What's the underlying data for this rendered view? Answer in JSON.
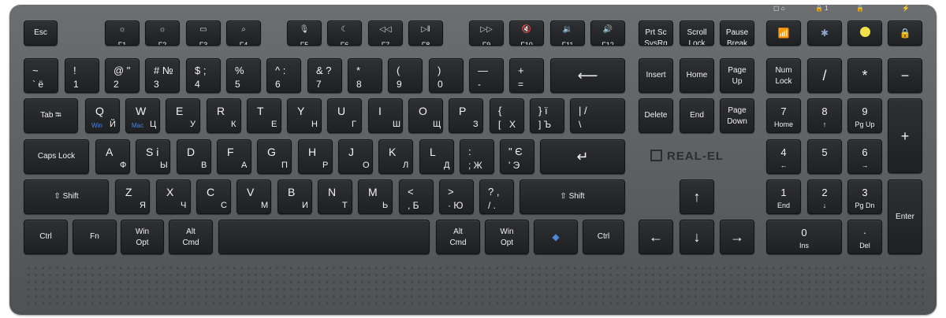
{
  "brand": "REAL-EL",
  "led_labels": [
    "▢ ⌂",
    "🔒 1",
    "🔒",
    "⚡"
  ],
  "rows": [
    [
      {
        "name": "esc",
        "a": "Esc"
      },
      {
        "name": "f1",
        "icon": "☼",
        "fn": "F1"
      },
      {
        "name": "f2",
        "icon": "☼",
        "fn": "F2"
      },
      {
        "name": "f3",
        "icon": "▭",
        "fn": "F3"
      },
      {
        "name": "f4",
        "icon": "⌕",
        "fn": "F4"
      },
      {
        "name": "f5",
        "icon": "🎙",
        "fn": "F5"
      },
      {
        "name": "f6",
        "icon": "☾",
        "fn": "F6"
      },
      {
        "name": "f7",
        "icon": "◁◁",
        "fn": "F7"
      },
      {
        "name": "f8",
        "icon": "▷‖",
        "fn": "F8"
      },
      {
        "name": "f9",
        "icon": "▷▷",
        "fn": "F9"
      },
      {
        "name": "f10",
        "icon": "🔇",
        "fn": "F10"
      },
      {
        "name": "f11",
        "icon": "🔉",
        "fn": "F11"
      },
      {
        "name": "f12",
        "icon": "🔊",
        "fn": "F12"
      },
      {
        "name": "prtsc",
        "a": "Prt Sc",
        "b": "SysRq"
      },
      {
        "name": "scroll-lock",
        "a": "Scroll",
        "b": "Lock"
      },
      {
        "name": "pause",
        "a": "Pause",
        "b": "Break"
      },
      {
        "name": "wifi",
        "icon": "📶"
      },
      {
        "name": "bluetooth",
        "icon": "✱"
      },
      {
        "name": "emoji",
        "smile": true
      },
      {
        "name": "lock",
        "icon": "🔒"
      }
    ],
    [
      {
        "name": "tilde",
        "tl": "~",
        "bl": "` ё",
        "tr": "",
        "br": ""
      },
      {
        "name": "1",
        "tl": "!",
        "bl": "1"
      },
      {
        "name": "2",
        "tl": "@ \"",
        "bl": "2"
      },
      {
        "name": "3",
        "tl": "# №",
        "bl": "3"
      },
      {
        "name": "4",
        "tl": "$ ;",
        "bl": "4"
      },
      {
        "name": "5",
        "tl": "%",
        "bl": "5"
      },
      {
        "name": "6",
        "tl": "^ :",
        "bl": "6"
      },
      {
        "name": "7",
        "tl": "& ?",
        "bl": "7"
      },
      {
        "name": "8",
        "tl": "*",
        "bl": "8"
      },
      {
        "name": "9",
        "tl": "(",
        "bl": "9"
      },
      {
        "name": "0",
        "tl": ")",
        "bl": "0"
      },
      {
        "name": "minus",
        "tl": "—",
        "bl": "-"
      },
      {
        "name": "equals",
        "tl": "+",
        "bl": "="
      },
      {
        "name": "backspace",
        "big": "⟵"
      },
      {
        "name": "insert",
        "a": "Insert"
      },
      {
        "name": "home",
        "a": "Home"
      },
      {
        "name": "page-up",
        "a": "Page",
        "b": "Up"
      },
      {
        "name": "num-lock",
        "a": "Num",
        "b": "Lock"
      },
      {
        "name": "np-slash",
        "big": "/"
      },
      {
        "name": "np-star",
        "big": "*"
      },
      {
        "name": "np-minus",
        "big": "−"
      }
    ],
    [
      {
        "name": "tab",
        "a": "Tab ⭾"
      },
      {
        "name": "q",
        "l": "Q",
        "r": "Й",
        "w": "Win"
      },
      {
        "name": "w",
        "l": "W",
        "r": "Ц",
        "w": "Mac"
      },
      {
        "name": "e",
        "l": "E",
        "r": "У"
      },
      {
        "name": "r",
        "l": "R",
        "r": "К"
      },
      {
        "name": "t",
        "l": "T",
        "r": "Е"
      },
      {
        "name": "y",
        "l": "Y",
        "r": "Н"
      },
      {
        "name": "u",
        "l": "U",
        "r": "Г"
      },
      {
        "name": "i",
        "l": "I",
        "r": "Ш"
      },
      {
        "name": "o",
        "l": "O",
        "r": "Щ"
      },
      {
        "name": "p",
        "l": "P",
        "r": "З"
      },
      {
        "name": "lbracket",
        "tl": "{",
        "bl": "[",
        "tr": "",
        "br": "Х"
      },
      {
        "name": "rbracket",
        "tl": "} ї",
        "bl": "] Ъ"
      },
      {
        "name": "backslash",
        "tl": "|  /",
        "bl": "\\"
      },
      {
        "name": "delete",
        "a": "Delete"
      },
      {
        "name": "end",
        "a": "End"
      },
      {
        "name": "page-down",
        "a": "Page",
        "b": "Down"
      },
      {
        "name": "np-7",
        "t": "7",
        "b": "Home"
      },
      {
        "name": "np-8",
        "t": "8",
        "b": "↑"
      },
      {
        "name": "np-9",
        "t": "9",
        "b": "Pg Up"
      },
      {
        "name": "np-plus",
        "big": "+"
      }
    ],
    [
      {
        "name": "caps-lock",
        "a": "Caps Lock"
      },
      {
        "name": "a",
        "l": "A",
        "r": "Ф"
      },
      {
        "name": "s",
        "l": "S і",
        "r": "Ы"
      },
      {
        "name": "d",
        "l": "D",
        "r": "В"
      },
      {
        "name": "f",
        "l": "F",
        "r": "А"
      },
      {
        "name": "g",
        "l": "G",
        "r": "П"
      },
      {
        "name": "h",
        "l": "H",
        "r": "Р"
      },
      {
        "name": "j",
        "l": "J",
        "r": "О"
      },
      {
        "name": "k",
        "l": "K",
        "r": "Л"
      },
      {
        "name": "l",
        "l": "L",
        "r": "Д"
      },
      {
        "name": "semicolon",
        "tl": ":",
        "bl": ";  Ж"
      },
      {
        "name": "quote",
        "tl": "\" Є",
        "bl": "'  Э"
      },
      {
        "name": "enter",
        "big": "↵"
      },
      {
        "name": "np-4",
        "t": "4",
        "b": "←"
      },
      {
        "name": "np-5",
        "t": "5",
        "b": ""
      },
      {
        "name": "np-6",
        "t": "6",
        "b": "→"
      }
    ],
    [
      {
        "name": "left-shift",
        "a": "⇧ Shift"
      },
      {
        "name": "z",
        "l": "Z",
        "r": "Я"
      },
      {
        "name": "x",
        "l": "X",
        "r": "Ч"
      },
      {
        "name": "c",
        "l": "C",
        "r": "С"
      },
      {
        "name": "v",
        "l": "V",
        "r": "М"
      },
      {
        "name": "b",
        "l": "B",
        "r": "И"
      },
      {
        "name": "n",
        "l": "N",
        "r": "Т"
      },
      {
        "name": "m",
        "l": "M",
        "r": "Ь"
      },
      {
        "name": "comma",
        "tl": "<",
        "bl": ", Б"
      },
      {
        "name": "period",
        "tl": ">",
        "bl": "· Ю"
      },
      {
        "name": "slash",
        "tl": "? ,",
        "bl": "/ ."
      },
      {
        "name": "right-shift",
        "a": "⇧ Shift"
      },
      {
        "name": "arrow-up",
        "big": "↑"
      },
      {
        "name": "np-1",
        "t": "1",
        "b": "End"
      },
      {
        "name": "np-2",
        "t": "2",
        "b": "↓"
      },
      {
        "name": "np-3",
        "t": "3",
        "b": "Pg Dn"
      },
      {
        "name": "np-enter",
        "a": "Enter"
      }
    ],
    [
      {
        "name": "left-ctrl",
        "a": "Ctrl"
      },
      {
        "name": "fn",
        "a": "Fn"
      },
      {
        "name": "left-win",
        "a": "Win",
        "b": "Opt"
      },
      {
        "name": "left-alt",
        "a": "Alt",
        "b": "Cmd"
      },
      {
        "name": "space",
        "a": ""
      },
      {
        "name": "right-alt",
        "a": "Alt",
        "b": "Cmd"
      },
      {
        "name": "right-win",
        "a": "Win",
        "b": "Opt"
      },
      {
        "name": "menu",
        "icon": "◆"
      },
      {
        "name": "right-ctrl",
        "a": "Ctrl"
      },
      {
        "name": "arrow-left",
        "big": "←"
      },
      {
        "name": "arrow-down",
        "big": "↓"
      },
      {
        "name": "arrow-right",
        "big": "→"
      },
      {
        "name": "np-0",
        "t": "0",
        "b": "Ins"
      },
      {
        "name": "np-dot",
        "t": "·",
        "b": "Del"
      }
    ]
  ]
}
